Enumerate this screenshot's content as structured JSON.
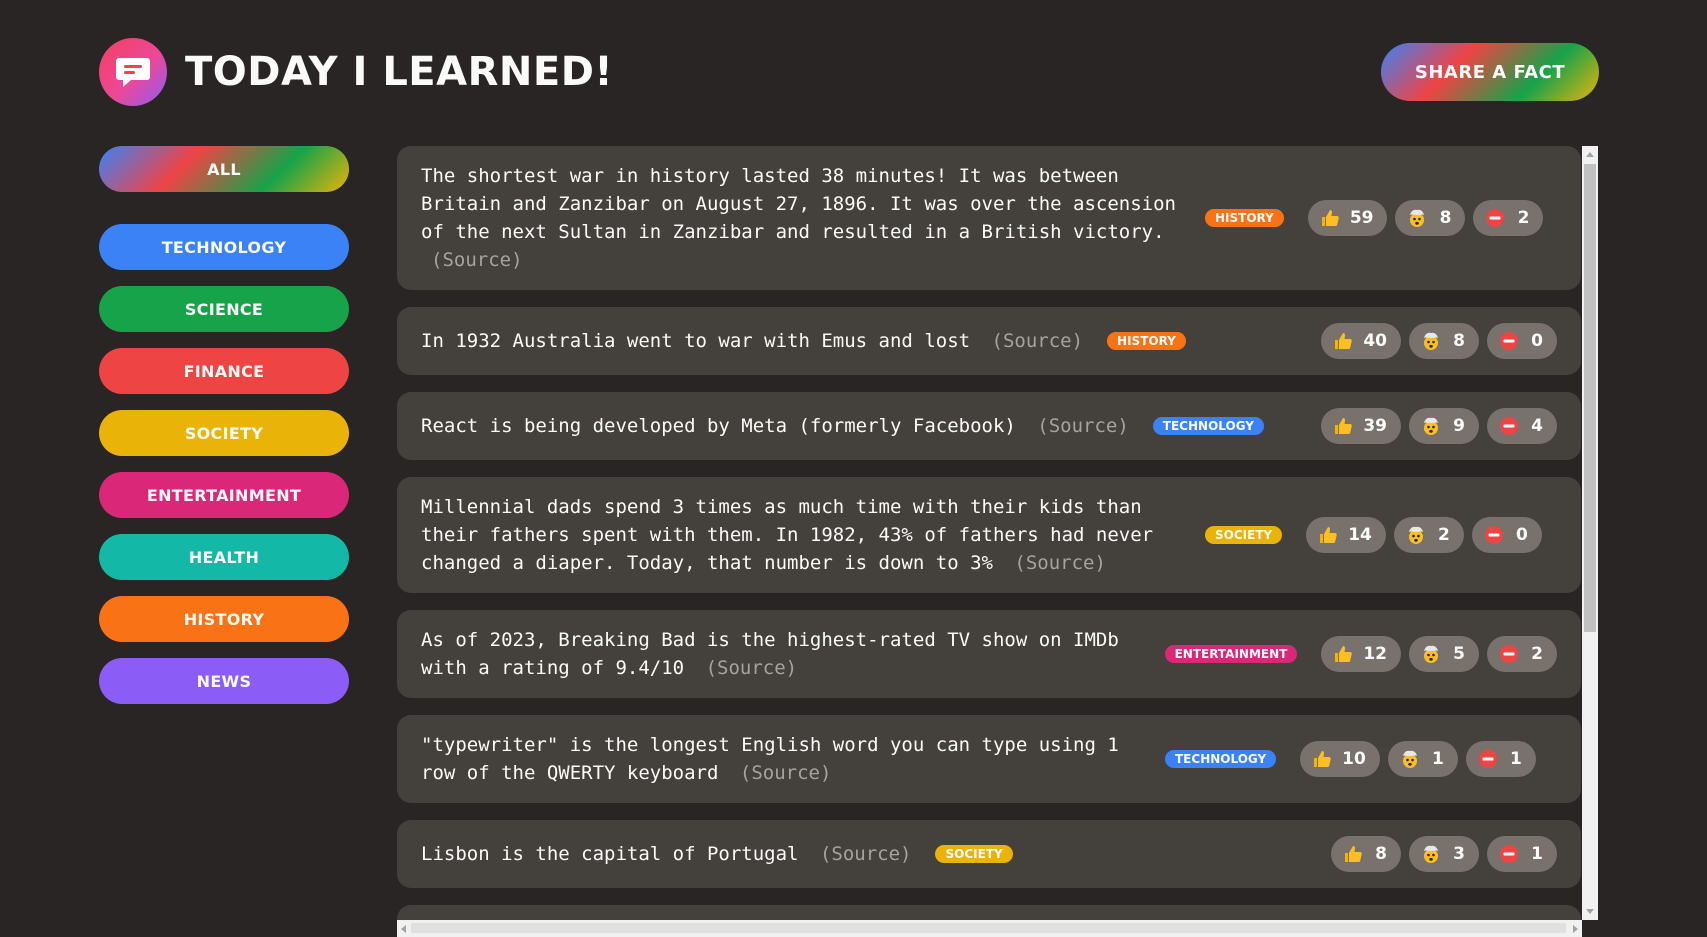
{
  "header": {
    "title": "Today I Learned!",
    "share_label": "Share a fact"
  },
  "categories": [
    {
      "label": "All"
    },
    {
      "label": "Technology",
      "color": "#3b82f6"
    },
    {
      "label": "Science",
      "color": "#16a34a"
    },
    {
      "label": "Finance",
      "color": "#ef4444"
    },
    {
      "label": "Society",
      "color": "#eab308"
    },
    {
      "label": "Entertainment",
      "color": "#db2777"
    },
    {
      "label": "Health",
      "color": "#14b8a6"
    },
    {
      "label": "History",
      "color": "#f97316"
    },
    {
      "label": "News",
      "color": "#8b5cf6"
    }
  ],
  "facts": [
    {
      "text": "The shortest war in history lasted 38 minutes! It was between Britain and Zanzibar on August 27, 1896. It was over the ascension of the next Sultan in Zanzibar and resulted in a British victory.",
      "source": "(Source)",
      "category": "History",
      "likes": "59",
      "mindblowing": "8",
      "false": "2"
    },
    {
      "text": "In 1932 Australia went to war with Emus and lost",
      "source": "(Source)",
      "category": "History",
      "likes": "40",
      "mindblowing": "8",
      "false": "0"
    },
    {
      "text": "React is being developed by Meta (formerly Facebook)",
      "source": "(Source)",
      "category": "Technology",
      "likes": "39",
      "mindblowing": "9",
      "false": "4"
    },
    {
      "text": "Millennial dads spend 3 times as much time with their kids than their fathers spent with them. In 1982, 43% of fathers had never changed a diaper. Today, that number is down to 3%",
      "source": "(Source)",
      "category": "Society",
      "likes": "14",
      "mindblowing": "2",
      "false": "0"
    },
    {
      "text": "As of 2023, Breaking Bad is the highest-rated TV show on IMDb with a rating of 9.4/10",
      "source": "(Source)",
      "category": "Entertainment",
      "likes": "12",
      "mindblowing": "5",
      "false": "2"
    },
    {
      "text": "\"typewriter\" is the longest English word you can type using 1 row of the QWERTY keyboard",
      "source": "(Source)",
      "category": "Technology",
      "likes": "10",
      "mindblowing": "1",
      "false": "1"
    },
    {
      "text": "Lisbon is the capital of Portugal",
      "source": "(Source)",
      "category": "Society",
      "likes": "8",
      "mindblowing": "3",
      "false": "1"
    }
  ],
  "colors": {
    "background": "#292524",
    "card": "#44403c",
    "vote_button": "#78716c",
    "source_text": "#a8a29e"
  },
  "icons": {
    "logo": "chat-bubble-icon",
    "like": "thumbs-up-icon",
    "mindblowing": "exploding-head-icon",
    "false": "no-entry-icon"
  }
}
